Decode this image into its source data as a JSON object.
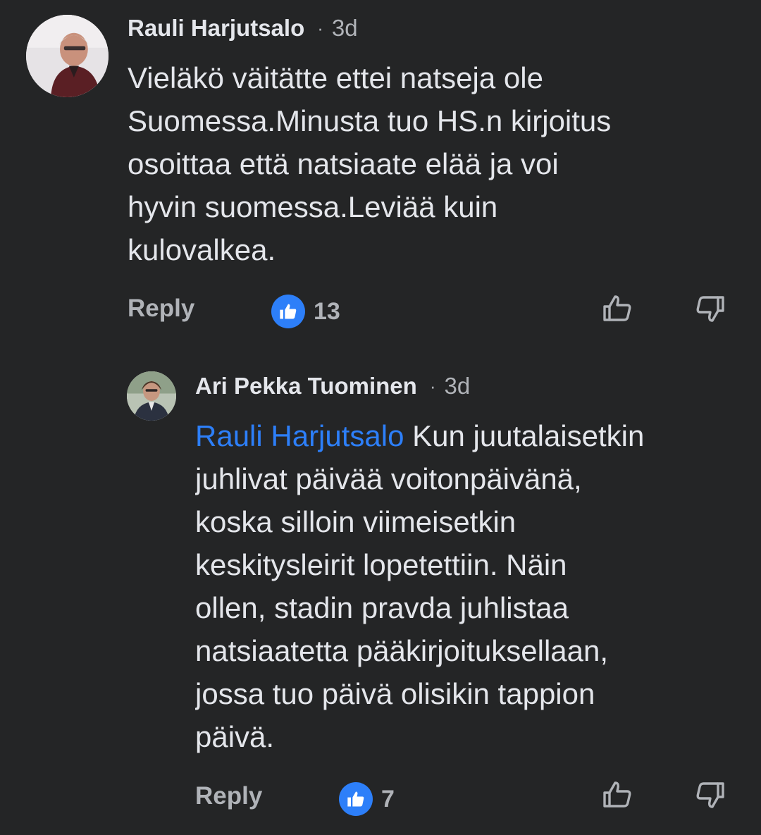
{
  "comments": [
    {
      "author": "Rauli Harjutsalo",
      "separator": "·",
      "time": "3d",
      "lines": [
        "Vieläkö väitätte ettei natseja ole",
        "Suomessa.Minusta tuo HS.n kirjoitus",
        "osoittaa että natsiaate elää ja voi",
        "hyvin suomessa.Leviää kuin",
        "kulovalkea."
      ],
      "reply_label": "Reply",
      "like_count": "13"
    },
    {
      "author": "Ari Pekka Tuominen",
      "separator": "·",
      "time": "3d",
      "mention": "Rauli Harjutsalo",
      "first_line_rest": " Kun juutalaisetkin",
      "lines": [
        "juhlivat päivää voitonpäivänä,",
        "koska silloin viimeisetkin",
        "keskitysleirit lopetettiin. Näin",
        "ollen, stadin pravda juhlistaa",
        "natsiaatetta pääkirjoituksellaan,",
        "jossa tuo päivä olisikin tappion",
        "päivä."
      ],
      "reply_label": "Reply",
      "like_count": "7"
    }
  ],
  "icons": {
    "like_reaction": "thumbs-up-filled-icon",
    "upvote": "thumbs-up-outline-icon",
    "downvote": "thumbs-down-outline-icon"
  },
  "colors": {
    "background": "#242526",
    "text": "#e4e6eb",
    "muted": "#b0b3b8",
    "accent": "#2d7ff9"
  }
}
